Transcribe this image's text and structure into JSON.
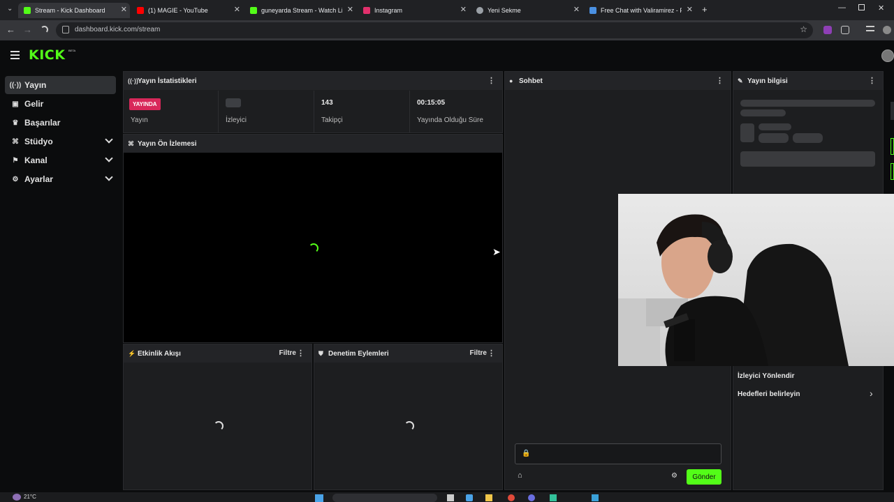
{
  "browser": {
    "tabs": [
      {
        "title": "Stream - Kick Dashboard",
        "color": "#53fc18",
        "active": true
      },
      {
        "title": "(1) MAGIE - YouTube",
        "color": "#ff0000"
      },
      {
        "title": "guneyarda Stream - Watch Live",
        "color": "#53fc18"
      },
      {
        "title": "Instagram",
        "color": "#e1306c"
      },
      {
        "title": "Yeni Sekme",
        "color": "#9aa0a6"
      },
      {
        "title": "Free Chat with Valiramirez - Pal",
        "color": "#4a90e2"
      }
    ],
    "url": "dashboard.kick.com/stream"
  },
  "app": {
    "logo": "KICK",
    "logo_badge": "BETA"
  },
  "sidebar": {
    "items": [
      {
        "label": "Yayın",
        "icon": "broadcast-icon",
        "active": true
      },
      {
        "label": "Gelir",
        "icon": "revenue-icon"
      },
      {
        "label": "Başarılar",
        "icon": "trophy-icon"
      },
      {
        "label": "Stüdyo",
        "icon": "studio-icon",
        "expandable": true
      },
      {
        "label": "Kanal",
        "icon": "channel-icon",
        "expandable": true
      },
      {
        "label": "Ayarlar",
        "icon": "gear-icon",
        "expandable": true
      }
    ]
  },
  "stats": {
    "title": "Yayın İstatistikleri",
    "status_badge": "YAYINDA",
    "status_label": "Yayın",
    "viewers_label": "İzleyici",
    "followers_value": "143",
    "followers_label": "Takipçi",
    "uptime_value": "00:15:05",
    "uptime_label": "Yayında Olduğu Süre"
  },
  "preview": {
    "title": "Yayın Ön İzlemesi"
  },
  "activity": {
    "title": "Etkinlik Akışı",
    "filter": "Filtre"
  },
  "moderation": {
    "title": "Denetim Eylemleri",
    "filter": "Filtre"
  },
  "chat": {
    "title": "Sohbet",
    "send": "Gönder"
  },
  "info": {
    "title": "Yayın bilgisi",
    "viewer_redirect": "İzleyici Yönlendir",
    "set_goals": "Hedefleri belirleyin"
  },
  "taskbar": {
    "temperature": "21°C"
  },
  "colors": {
    "accent": "#53fc18",
    "live": "#d8285a"
  }
}
